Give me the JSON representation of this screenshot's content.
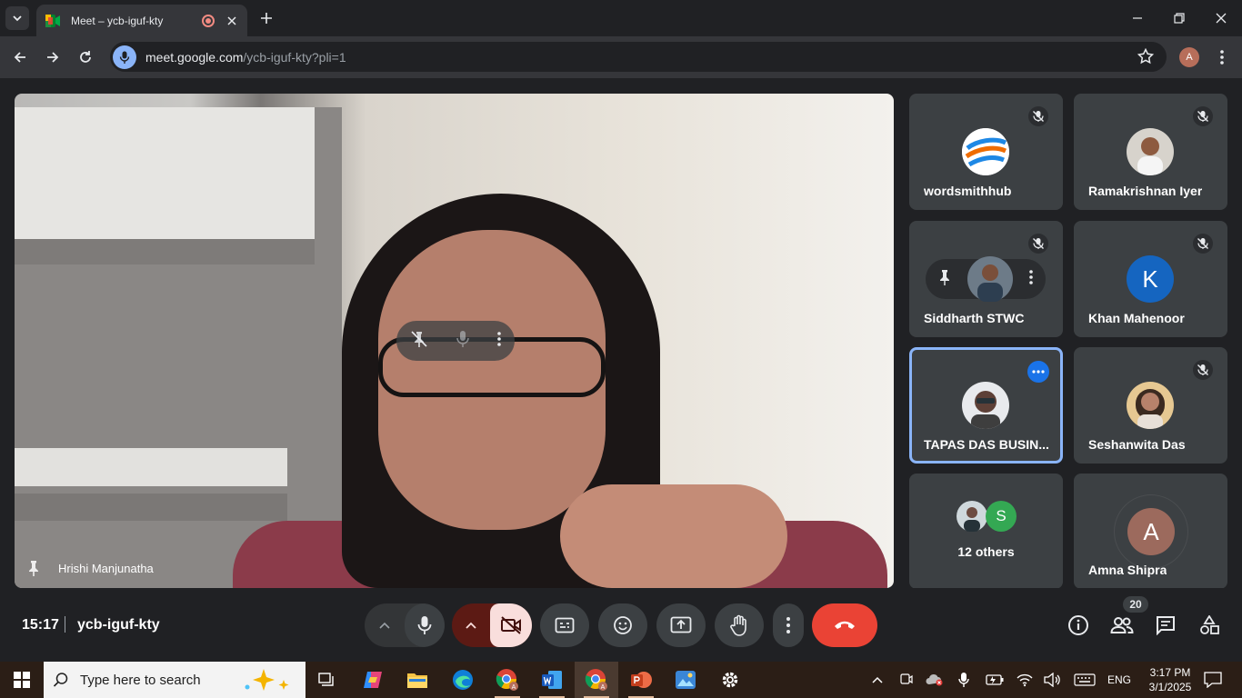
{
  "browser": {
    "tab_title": "Meet – ycb-iguf-kty",
    "url_host": "meet.google.com",
    "url_path": "/ycb-iguf-kty?pli=1",
    "profile_initial": "A"
  },
  "main_video": {
    "speaker_name": "Hrishi Manjunatha"
  },
  "tiles": [
    {
      "name": "wordsmithhub",
      "muted": true
    },
    {
      "name": "Ramakrishnan Iyer",
      "muted": true
    },
    {
      "name": "Siddharth STWC",
      "muted": true
    },
    {
      "name": "Khan Mahenoor",
      "muted": true,
      "initial": "K",
      "avatar_color": "#1565c0"
    },
    {
      "name": "TAPAS DAS BUSIN...",
      "muted": false
    },
    {
      "name": "Seshanwita Das",
      "muted": true
    },
    {
      "name": "12 others",
      "initial": "S",
      "avatar_color": "#34a853"
    },
    {
      "name": "Amna Shipra",
      "initial": "A",
      "avatar_color": "#9c6a5d"
    }
  ],
  "meeting": {
    "time": "15:17",
    "code": "ycb-iguf-kty",
    "participant_count": "20"
  },
  "taskbar": {
    "search_placeholder": "Type here to search",
    "language": "ENG",
    "time": "3:17 PM",
    "date": "3/1/2025"
  },
  "colors": {
    "end_call": "#ea4335",
    "camera_off_bg": "#f9dedc",
    "camera_group": "#5c1a14",
    "accent": "#8ab4f8"
  }
}
